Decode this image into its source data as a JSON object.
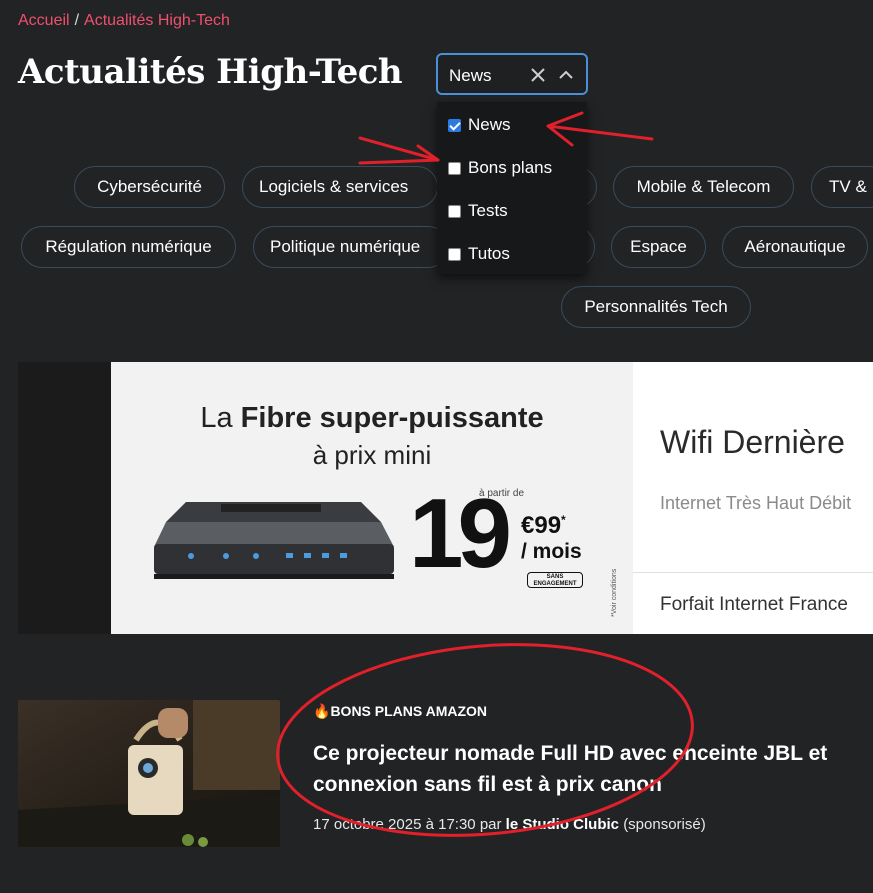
{
  "breadcrumb": {
    "home": "Accueil",
    "separator": "/",
    "current": "Actualités High-Tech"
  },
  "page_title": "Actualités High-Tech",
  "filter_select": {
    "value": "News",
    "options": [
      {
        "label": "News",
        "checked": true
      },
      {
        "label": "Bons plans",
        "checked": false
      },
      {
        "label": "Tests",
        "checked": false
      },
      {
        "label": "Tutos",
        "checked": false
      }
    ]
  },
  "topics": [
    "Cybersécurité",
    "Logiciels & services",
    "",
    "Mobile & Telecom",
    "TV & ",
    "Régulation numérique",
    "Politique numérique",
    "",
    "Espace",
    "Aéronautique",
    "Personnalités Tech"
  ],
  "ad": {
    "headline_light_1": "La ",
    "headline_bold": "Fibre super-puissante",
    "headline_line2": "à prix mini",
    "price_prefix": "à partir de",
    "price_big": "19",
    "price_cents": "€99",
    "price_star": "*",
    "price_period": "/ mois",
    "badge": "SANS ENGAGEMENT",
    "disclaimer": "*Voir conditions",
    "right_title": "Wifi Dernière",
    "right_sub": "Internet Très Haut Débit",
    "right_footer": "Forfait Internet France"
  },
  "article": {
    "category_emoji": "🔥",
    "category": "BONS PLANS AMAZON",
    "headline": "Ce projecteur nomade Full HD avec enceinte JBL et connexion sans fil est à prix canon",
    "date": "17 octobre 2025 à 17:30",
    "by": "par",
    "author": "le Studio Clubic",
    "sponsored": "(sponsorisé)"
  },
  "colors": {
    "accent": "#f0506e",
    "background": "#212325",
    "select_border": "#4a90d9",
    "annotation": "#e0202a"
  }
}
